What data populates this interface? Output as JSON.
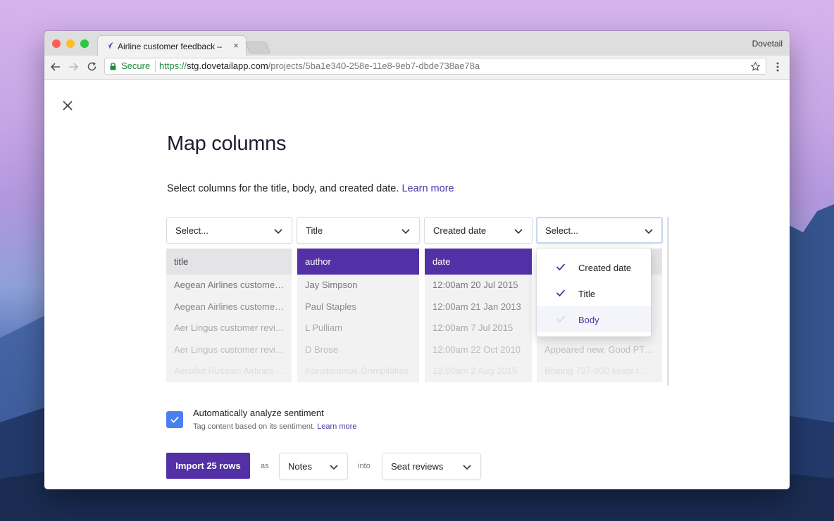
{
  "browser": {
    "tab_title": "Airline customer feedback – Do",
    "tab_close": "×",
    "profile_name": "Dovetail",
    "secure_label": "Secure",
    "url_scheme": "https://",
    "url_host": "stg.dovetailapp.com",
    "url_path": "/projects/5ba1e340-258e-11e8-9eb7-dbde738ae78a"
  },
  "page": {
    "title": "Map columns",
    "description": "Select columns for the title, body, and created date.",
    "learn_more": "Learn more"
  },
  "columns": [
    {
      "select_label": "Select...",
      "header": "title",
      "mapped": false,
      "cells": [
        "Aegean Airlines customer review",
        "Aegean Airlines customer review",
        "Aer Lingus customer review",
        "Aer Lingus customer review",
        "Aeroflot Russian Airlines customer review"
      ]
    },
    {
      "select_label": "Title",
      "header": "author",
      "mapped": true,
      "cells": [
        "Jay Simpson",
        "Paul Staples",
        "L Pulliam",
        "D Brose",
        "Konstantinos Grimpilakos"
      ]
    },
    {
      "select_label": "Created date",
      "header": "date",
      "mapped": true,
      "cells": [
        "12:00am 20 Jul 2015",
        "12:00am 21 Jan 2013",
        "12:00am 7 Jul 2015",
        "12:00am 22 Oct 2010",
        "12:00am 2 Aug 2015"
      ]
    },
    {
      "select_label": "Select...",
      "header": "",
      "mapped": false,
      "cells": [
        "",
        "",
        "",
        "Appeared new. Good PTV screens",
        "Boeing 737-800 seats f..."
      ]
    }
  ],
  "dropdown_menu": {
    "items": [
      {
        "label": "Created date",
        "checked": true
      },
      {
        "label": "Title",
        "checked": true
      },
      {
        "label": "Body",
        "checked": false
      }
    ]
  },
  "sentiment": {
    "checked": true,
    "label": "Automatically analyze sentiment",
    "help": "Tag content based on its sentiment.",
    "help_link": "Learn more"
  },
  "footer": {
    "import_button": "Import 25 rows",
    "as_label": "as",
    "type_select": "Notes",
    "into_label": "into",
    "project_select": "Seat reviews"
  },
  "colors": {
    "accent": "#5230a6",
    "link": "#4c35a8",
    "checkbox": "#4a7ff0",
    "secure_green": "#1e8a3c"
  }
}
